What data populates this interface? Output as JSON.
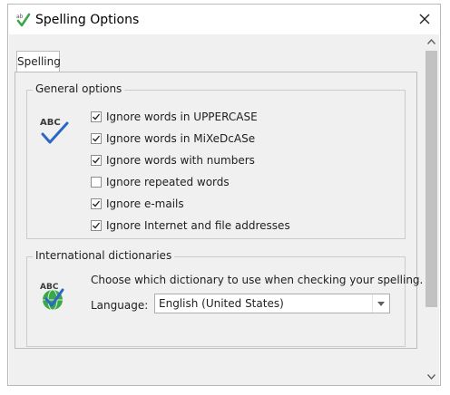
{
  "window": {
    "title": "Spelling Options",
    "icon": "spell-check-icon",
    "close_icon": "close-icon"
  },
  "tabs": [
    {
      "label": "Spelling",
      "selected": true
    }
  ],
  "general_options": {
    "title": "General options",
    "icon": "abc-check-icon",
    "checkboxes": [
      {
        "label": "Ignore words in UPPERCASE",
        "checked": true
      },
      {
        "label": "Ignore words in MiXeDcASe",
        "checked": true
      },
      {
        "label": "Ignore words with numbers",
        "checked": true
      },
      {
        "label": "Ignore repeated words",
        "checked": false
      },
      {
        "label": "Ignore e-mails",
        "checked": true
      },
      {
        "label": "Ignore Internet and file addresses",
        "checked": true
      }
    ]
  },
  "international_dictionaries": {
    "title": "International dictionaries",
    "icon": "abc-globe-icon",
    "description": "Choose which dictionary to use when checking your spelling.",
    "language_label": "Language:",
    "language_value": "English (United States)"
  },
  "colors": {
    "check_blue": "#2b67c5",
    "globe_green": "#3aa84a",
    "panel_bg": "#f0f0f0"
  }
}
